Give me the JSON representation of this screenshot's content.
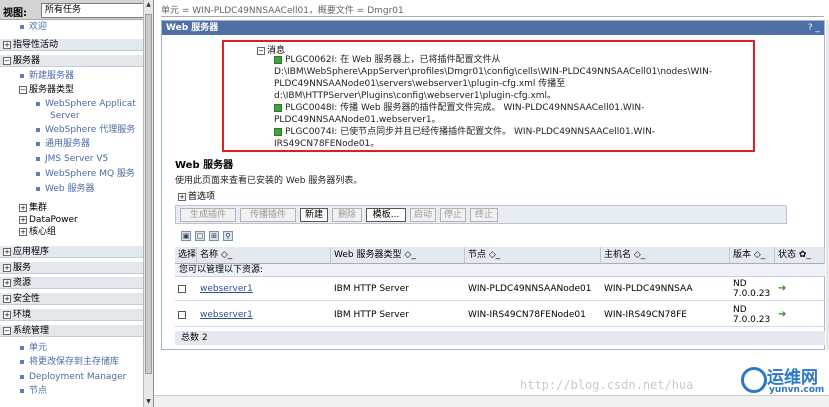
{
  "nav": {
    "view_label": "视图:",
    "view_value": "所有任务",
    "items": [
      {
        "label": "欢迎",
        "type": "link"
      },
      {
        "label": "指导性活动",
        "type": "section",
        "toggle": "⊞"
      },
      {
        "label": "服务器",
        "type": "section",
        "toggle": "⊟"
      },
      {
        "label": "新建服务器",
        "type": "link"
      },
      {
        "label": "服务器类型",
        "type": "group",
        "toggle": "⊟"
      },
      {
        "label": "WebSphere Applicat",
        "type": "link"
      },
      {
        "label": "Server",
        "type": "link-cont"
      },
      {
        "label": "WebSphere 代理服务",
        "type": "link"
      },
      {
        "label": "通用服务器",
        "type": "link"
      },
      {
        "label": "JMS Server V5",
        "type": "link"
      },
      {
        "label": "WebSphere MQ 服务",
        "type": "link"
      },
      {
        "label": "Web 服务器",
        "type": "link"
      },
      {
        "label": "集群",
        "type": "group",
        "toggle": "⊞"
      },
      {
        "label": "DataPower",
        "type": "group",
        "toggle": "⊞"
      },
      {
        "label": "核心组",
        "type": "group",
        "toggle": "⊞"
      },
      {
        "label": "应用程序",
        "type": "section",
        "toggle": "⊞"
      },
      {
        "label": "服务",
        "type": "section",
        "toggle": "⊞"
      },
      {
        "label": "资源",
        "type": "section",
        "toggle": "⊞"
      },
      {
        "label": "安全性",
        "type": "section",
        "toggle": "⊞"
      },
      {
        "label": "环境",
        "type": "section",
        "toggle": "⊞"
      },
      {
        "label": "系统管理",
        "type": "section",
        "toggle": "⊟"
      },
      {
        "label": "单元",
        "type": "link"
      },
      {
        "label": "将更改保存到主存储库",
        "type": "link"
      },
      {
        "label": "Deployment Manager",
        "type": "link"
      },
      {
        "label": "节点",
        "type": "link"
      }
    ]
  },
  "breadcrumb": "单元 = WIN-PLDC49NNSAACell01，概要文件 = Dmgr01",
  "portlet": {
    "title": "Web 服务器",
    "title_buttons": "? _",
    "messages_header": "消息",
    "messages": [
      "PLGC0062I: 在 Web 服务器上，已将插件配置文件从 D:\\IBM\\WebSphere\\AppServer\\profiles\\Dmgr01\\config\\cells\\WIN-PLDC49NNSAACell01\\nodes\\WIN-PLDC49NNSAANode01\\servers\\webserver1\\plugin-cfg.xml 传播至 d:\\IBM\\HTTPServer\\Plugins\\config\\webserver1\\plugin-cfg.xml。",
      "PLGC0048I: 传播 Web 服务器的插件配置文件完成。 WIN-PLDC49NNSAACell01.WIN-PLDC49NNSAANode01.webserver1。",
      "PLGC0074I: 已使节点同步并且已经传播插件配置文件。 WIN-PLDC49NNSAACell01.WIN-IRS49CN78FENode01。"
    ],
    "heading": "Web 服务器",
    "description": "使用此页面来查看已安装的 Web 服务器列表。",
    "preferences": "首选项",
    "buttons": [
      {
        "label": "生成插件",
        "active": false
      },
      {
        "label": "传播插件",
        "active": false
      },
      {
        "label": "新建",
        "active": true
      },
      {
        "label": "删除",
        "active": false
      },
      {
        "label": "模板...",
        "active": true
      },
      {
        "label": "启动",
        "active": false
      },
      {
        "label": "停止",
        "active": false
      },
      {
        "label": "终止",
        "active": false
      }
    ],
    "table": {
      "headers": [
        "选择",
        "名称 ◇_",
        "Web 服务器类型 ◇_",
        "节点 ◇_",
        "主机名 ◇_",
        "版本 ◇_",
        "状态 ✿_"
      ],
      "subheader": "您可以管理以下资源:",
      "rows": [
        {
          "name": "webserver1",
          "type": "IBM HTTP Server",
          "node": "WIN-PLDC49NNSAANode01",
          "host": "WIN-PLDC49NNSAA",
          "version": "ND 7.0.0.23",
          "status": "➔"
        },
        {
          "name": "webserver1",
          "type": "IBM HTTP Server",
          "node": "WIN-IRS49CN78FENode01",
          "host": "WIN-IRS49CN78FE",
          "version": "ND 7.0.0.23",
          "status": "➔"
        }
      ],
      "total": "总数 2"
    }
  },
  "watermark": "http://blog.csdn.net/hua",
  "logo": {
    "name": "运维网",
    "domain": "yunvn.com"
  },
  "colors": {
    "title_bar": "#4f6fa6",
    "highlight_box": "#e11b22",
    "link": "#2d4d9e"
  }
}
